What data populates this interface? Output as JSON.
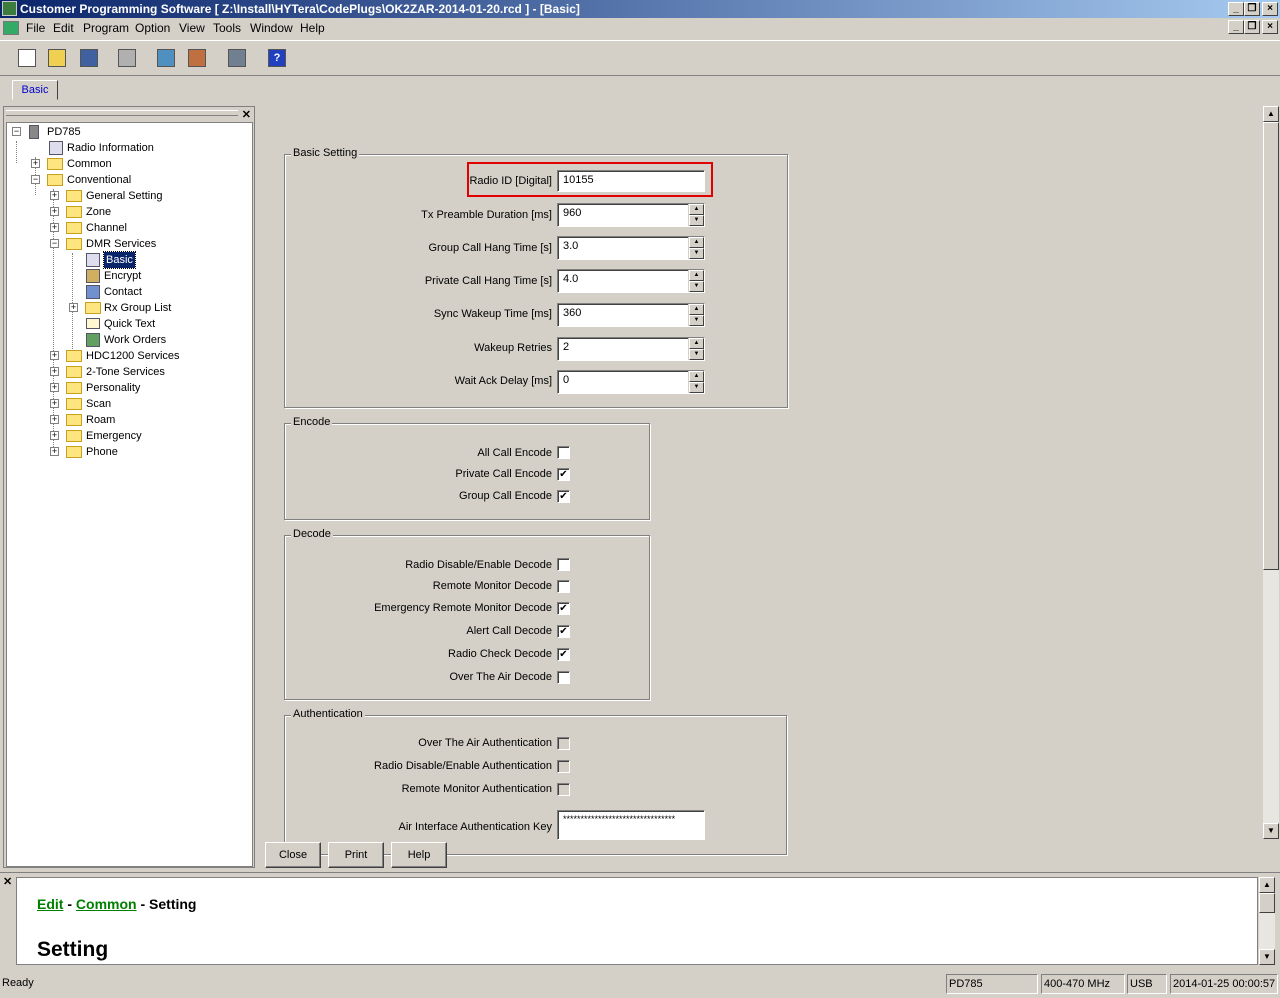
{
  "window": {
    "title": "Customer Programming Software [ Z:\\Install\\HYTera\\CodePlugs\\OK2ZAR-2014-01-20.rcd ] - [Basic]"
  },
  "menu": [
    "File",
    "Edit",
    "Program",
    "Option",
    "View",
    "Tools",
    "Window",
    "Help"
  ],
  "toolbar_icons": [
    "new-icon",
    "open-icon",
    "save-icon",
    "print-icon",
    "read-radio-icon",
    "write-radio-icon",
    "clone-icon",
    "help-icon"
  ],
  "tabs": [
    {
      "label": "Basic"
    }
  ],
  "tree": {
    "items": [
      {
        "label": "PD785"
      },
      {
        "label": "Radio Information"
      },
      {
        "label": "Common"
      },
      {
        "label": "Conventional"
      },
      {
        "label": "General Setting"
      },
      {
        "label": "Zone"
      },
      {
        "label": "Channel"
      },
      {
        "label": "DMR Services"
      },
      {
        "label": "Basic"
      },
      {
        "label": "Encrypt"
      },
      {
        "label": "Contact"
      },
      {
        "label": "Rx Group List"
      },
      {
        "label": "Quick Text"
      },
      {
        "label": "Work Orders"
      },
      {
        "label": "HDC1200 Services"
      },
      {
        "label": "2-Tone Services"
      },
      {
        "label": "Personality"
      },
      {
        "label": "Scan"
      },
      {
        "label": "Roam"
      },
      {
        "label": "Emergency"
      },
      {
        "label": "Phone"
      }
    ]
  },
  "basic_setting": {
    "title": "Basic Setting",
    "fields": [
      {
        "label": "Radio ID [Digital]",
        "value": "10155"
      },
      {
        "label": "Tx Preamble Duration [ms]",
        "value": "960"
      },
      {
        "label": "Group Call Hang Time [s]",
        "value": "3.0"
      },
      {
        "label": "Private Call Hang Time [s]",
        "value": "4.0"
      },
      {
        "label": "Sync Wakeup Time [ms]",
        "value": "360"
      },
      {
        "label": "Wakeup Retries",
        "value": "2"
      },
      {
        "label": "Wait Ack Delay [ms]",
        "value": "0"
      }
    ]
  },
  "encode": {
    "title": "Encode",
    "items": [
      {
        "label": "All Call Encode",
        "checked": false
      },
      {
        "label": "Private Call Encode",
        "checked": true
      },
      {
        "label": "Group Call Encode",
        "checked": true
      }
    ]
  },
  "decode": {
    "title": "Decode",
    "items": [
      {
        "label": "Radio Disable/Enable Decode",
        "checked": false
      },
      {
        "label": "Remote Monitor Decode",
        "checked": false
      },
      {
        "label": "Emergency Remote Monitor Decode",
        "checked": true
      },
      {
        "label": "Alert Call Decode",
        "checked": true
      },
      {
        "label": "Radio Check Decode",
        "checked": true
      },
      {
        "label": "Over The Air Decode",
        "checked": false
      }
    ]
  },
  "authentication": {
    "title": "Authentication",
    "items": [
      {
        "label": "Over The Air Authentication",
        "checked": false
      },
      {
        "label": "Radio Disable/Enable Authentication",
        "checked": false
      },
      {
        "label": "Remote Monitor Authentication",
        "checked": false
      }
    ],
    "key_label": "Air Interface Authentication Key",
    "key_value": "********************************"
  },
  "buttons": {
    "close": "Close",
    "print": "Print",
    "help": "Help"
  },
  "help": {
    "crumb_edit": "Edit",
    "crumb_sep1": " - ",
    "crumb_common": "Common",
    "crumb_sep2": " - ",
    "crumb_setting": "Setting",
    "title": "Setting"
  },
  "status": {
    "text": "Ready",
    "model": "PD785",
    "band": "400-470 MHz",
    "port": "USB",
    "datetime": "2014-01-25 00:00:57"
  },
  "colors": {
    "highlight": "#e00000",
    "link": "#008000",
    "selection": "#0a246a"
  }
}
